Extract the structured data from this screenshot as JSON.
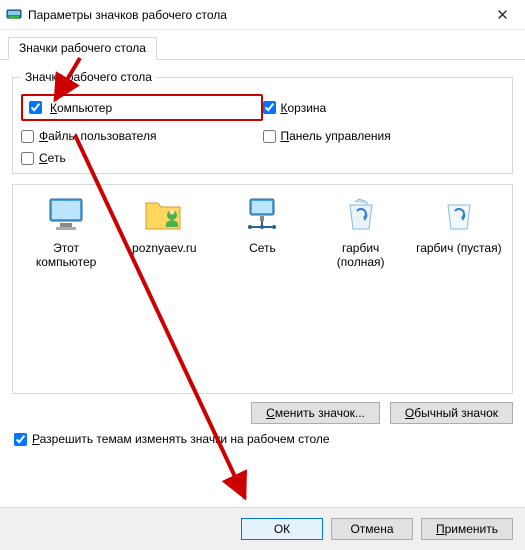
{
  "window": {
    "title": "Параметры значков рабочего стола"
  },
  "tab": {
    "label": "Значки рабочего стола"
  },
  "group": {
    "legend": "Значки рабочего стола",
    "checkboxes": {
      "computer": {
        "label": "Компьютер",
        "checked": true,
        "highlight": true,
        "accessKey": "К"
      },
      "recycle": {
        "label": "Корзина",
        "checked": true,
        "accessKey": "К"
      },
      "userfiles": {
        "label": "Файлы пользователя",
        "checked": false,
        "accessKey": "Ф"
      },
      "cpanel": {
        "label": "Панель управления",
        "checked": false,
        "accessKey": "П"
      },
      "network": {
        "label": "Сеть",
        "checked": false,
        "accessKey": "С"
      }
    }
  },
  "preview": {
    "items": [
      {
        "icon": "monitor",
        "label": "Этот компьютер"
      },
      {
        "icon": "folder-user",
        "label": "poznyaev.ru"
      },
      {
        "icon": "monitor-net",
        "label": "Сеть"
      },
      {
        "icon": "recycle-full",
        "label": "гарбич (полная)"
      },
      {
        "icon": "recycle-empty",
        "label": "гарбич (пустая)"
      }
    ]
  },
  "buttons": {
    "changeIcon": "Сменить значок...",
    "defaultIcon": "Обычный значок"
  },
  "allowThemes": {
    "label": "Разрешить темам изменять значки на рабочем столе",
    "checked": true,
    "accessKey": "Р"
  },
  "dialogButtons": {
    "ok": "ОК",
    "cancel": "Отмена",
    "apply": "Применить"
  }
}
